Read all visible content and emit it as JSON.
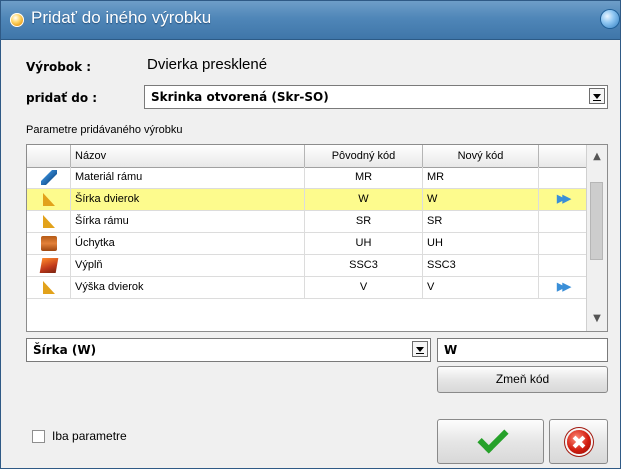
{
  "window": {
    "title": "Pridať do iného výrobku"
  },
  "form": {
    "product_label": "Výrobok :",
    "product_value": "Dvierka presklené",
    "add_to_label": "pridať do :",
    "add_to_value": "Skrinka otvorená (Skr-SO)"
  },
  "params": {
    "section_label": "Parametre pridávaného výrobku",
    "columns": [
      "Názov",
      "Pôvodný kód",
      "Nový kód"
    ],
    "rows": [
      {
        "icon": "material-icon",
        "name": "Materiál rámu",
        "orig": "MR",
        "new": "MR",
        "action": ""
      },
      {
        "icon": "triangle-icon",
        "name": "Šírka dvierok",
        "orig": "W",
        "new": "W",
        "action": "double-arrow-icon",
        "selected": true
      },
      {
        "icon": "triangle-icon",
        "name": "Šírka rámu",
        "orig": "SR",
        "new": "SR",
        "action": ""
      },
      {
        "icon": "handle-icon",
        "name": "Úchytka",
        "orig": "UH",
        "new": "UH",
        "action": ""
      },
      {
        "icon": "fill-icon",
        "name": "Výplň",
        "orig": "SSC3",
        "new": "SSC3",
        "action": ""
      },
      {
        "icon": "triangle-icon",
        "name": "Výška dvierok",
        "orig": "V",
        "new": "V",
        "action": "double-arrow-icon"
      }
    ]
  },
  "edit": {
    "param_select_value": "Šírka (W)",
    "code_value": "W",
    "change_code_label": "Zmeň kód"
  },
  "footer": {
    "only_params_label": "Iba parametre",
    "only_params_checked": false
  },
  "colors": {
    "selected_row": "#fdfb8d",
    "title_bar": "#4f86b8"
  }
}
